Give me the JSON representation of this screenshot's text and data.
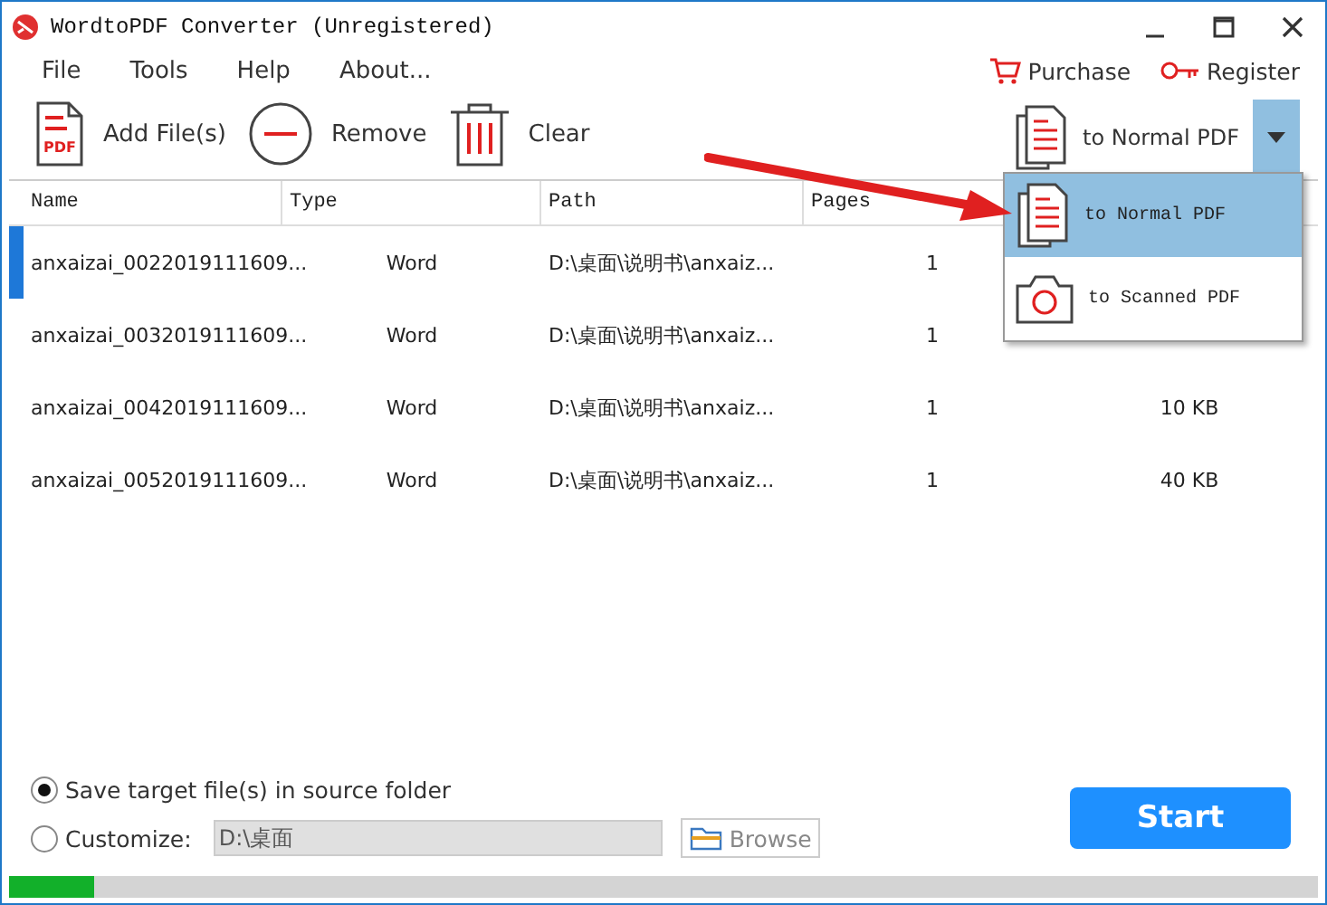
{
  "window": {
    "title": "WordtoPDF Converter (Unregistered)"
  },
  "menu": [
    "File",
    "Tools",
    "Help",
    "About..."
  ],
  "links": [
    {
      "kind": "cart",
      "label": "Purchase"
    },
    {
      "kind": "key",
      "label": "Register"
    }
  ],
  "toolbar": [
    {
      "kind": "add",
      "label": "Add File(s)",
      "icon_text": "PDF"
    },
    {
      "kind": "remove",
      "label": "Remove"
    },
    {
      "kind": "clear",
      "label": "Clear"
    }
  ],
  "mode_dropdown": {
    "value": "to Normal PDF",
    "expanded": true,
    "options": [
      {
        "kind": "normal",
        "label": "to Normal PDF",
        "selected": true
      },
      {
        "kind": "scanned",
        "label": "to Scanned PDF",
        "selected": false
      }
    ]
  },
  "table": {
    "columns": [
      "Name",
      "Type",
      "Path",
      "Pages"
    ],
    "rows": [
      {
        "selected": true,
        "cells": [
          "anxaizai_0022019111609...",
          "Word",
          "D:\\桌面\\说明书\\anxaiz...",
          "1"
        ]
      },
      {
        "selected": false,
        "cells": [
          "anxaizai_0032019111609...",
          "Word",
          "D:\\桌面\\说明书\\anxaiz...",
          "1"
        ]
      },
      {
        "selected": false,
        "cells": [
          "anxaizai_0042019111609...",
          "Word",
          "D:\\桌面\\说明书\\anxaiz...",
          "1",
          "10 KB"
        ]
      },
      {
        "selected": false,
        "cells": [
          "anxaizai_0052019111609...",
          "Word",
          "D:\\桌面\\说明书\\anxaiz...",
          "1",
          "40 KB"
        ]
      }
    ]
  },
  "output": {
    "options": [
      {
        "label": "Save target file(s) in source folder",
        "selected": true
      },
      {
        "label": "Customize:",
        "selected": false
      }
    ],
    "path": "D:\\桌面",
    "browse": "Browse"
  },
  "start": "Start",
  "progress": {
    "level": 0.065
  }
}
